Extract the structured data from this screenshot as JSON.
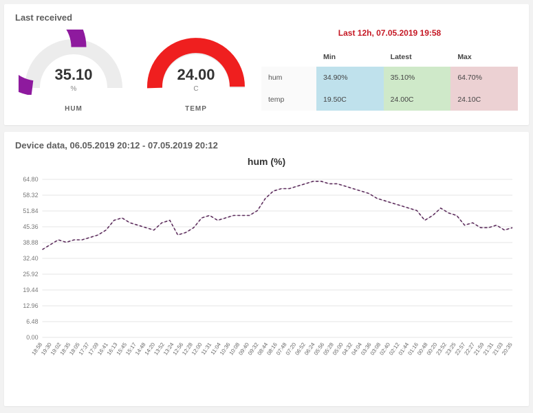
{
  "top": {
    "title": "Last received",
    "gauges": [
      {
        "key": "hum",
        "name": "HUM",
        "value": "35.10",
        "unit": "%",
        "fill": "#8e1a9e",
        "pct": 0.54
      },
      {
        "key": "temp",
        "name": "TEMP",
        "value": "24.00",
        "unit": "C",
        "fill": "#ef1f1f",
        "pct": 0.99
      }
    ],
    "summary": {
      "title": "Last 12h, 07.05.2019 19:58",
      "cols": [
        "Min",
        "Latest",
        "Max"
      ],
      "rows": [
        {
          "label": "hum",
          "min": "34.90%",
          "latest": "35.10%",
          "max": "64.70%"
        },
        {
          "label": "temp",
          "min": "19.50C",
          "latest": "24.00C",
          "max": "24.10C"
        }
      ]
    }
  },
  "bottom": {
    "title": "Device data, 06.05.2019 20:12 - 07.05.2019 20:12"
  },
  "chart_data": {
    "type": "line",
    "title": "hum (%)",
    "ylabel": "",
    "xlabel": "",
    "ylim": [
      0,
      64.8
    ],
    "yticks": [
      0.0,
      6.48,
      12.96,
      19.44,
      25.92,
      32.4,
      38.88,
      45.36,
      51.84,
      58.32,
      64.8
    ],
    "categories": [
      "18:58",
      "19:30",
      "19:02",
      "18:35",
      "18:05",
      "17:37",
      "17:09",
      "16:41",
      "16:13",
      "15:45",
      "15:17",
      "14:48",
      "14:20",
      "13:52",
      "13:24",
      "12:56",
      "12:28",
      "12:00",
      "11:31",
      "11:04",
      "10:36",
      "10:08",
      "09:40",
      "09:32",
      "08:44",
      "08:16",
      "07:48",
      "07:20",
      "06:52",
      "06:24",
      "05:56",
      "05:28",
      "05:00",
      "04:32",
      "04:04",
      "03:36",
      "03:08",
      "02:40",
      "02:12",
      "01:44",
      "01:16",
      "00:48",
      "00:20",
      "23:52",
      "23:25",
      "22:57",
      "22:27",
      "21:59",
      "21:31",
      "21:03",
      "20:35"
    ],
    "series": [
      {
        "name": "hum",
        "values": [
          36,
          38,
          40,
          39,
          40,
          40,
          41,
          42,
          44,
          48,
          49,
          47,
          46,
          45,
          44,
          47,
          48,
          42,
          43,
          45,
          49,
          50,
          48,
          49,
          50,
          50,
          50,
          52,
          57,
          60,
          61,
          61,
          62,
          63,
          64,
          64,
          63,
          63,
          62,
          61,
          60,
          59,
          57,
          56,
          55,
          54,
          53,
          52,
          48,
          50,
          53,
          51,
          50,
          46,
          47,
          45,
          45,
          46,
          44,
          45
        ]
      }
    ]
  }
}
